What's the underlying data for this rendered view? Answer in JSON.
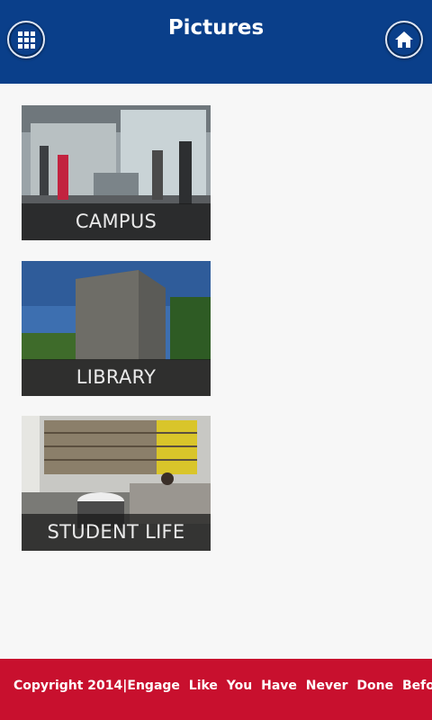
{
  "header": {
    "title": "Pictures",
    "menu_icon": "grid-menu-icon",
    "home_icon": "home-icon"
  },
  "gallery": {
    "items": [
      {
        "label": "CAMPUS"
      },
      {
        "label": "LIBRARY"
      },
      {
        "label": "STUDENT LIFE"
      }
    ]
  },
  "footer": {
    "copyright": "Copyright 2014",
    "separator": "|",
    "tagline": "Engage Like You Have Never Done Before"
  },
  "colors": {
    "header_bg": "#0a3f8a",
    "footer_bg": "#c8102e",
    "page_bg": "#f7f7f7"
  }
}
